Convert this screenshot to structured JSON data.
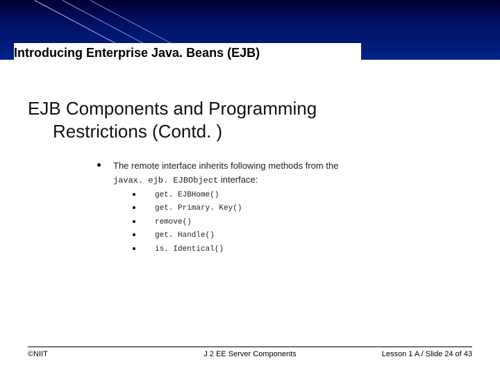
{
  "header": {
    "title": "Introducing Enterprise Java. Beans (EJB)"
  },
  "main": {
    "heading_line1": "EJB Components and Programming",
    "heading_line2": "Restrictions (Contd. )",
    "bullet_intro": "The remote interface inherits following methods from the",
    "bullet_code": "javax. ejb. EJBObject",
    "bullet_intro_tail": " interface:",
    "methods": [
      "get. EJBHome()",
      "get. Primary. Key()",
      "remove()",
      "get. Handle()",
      "is. Identical()"
    ]
  },
  "footer": {
    "left": "©NIIT",
    "center": "J 2 EE Server Components",
    "right": "Lesson 1 A / Slide 24 of 43"
  }
}
